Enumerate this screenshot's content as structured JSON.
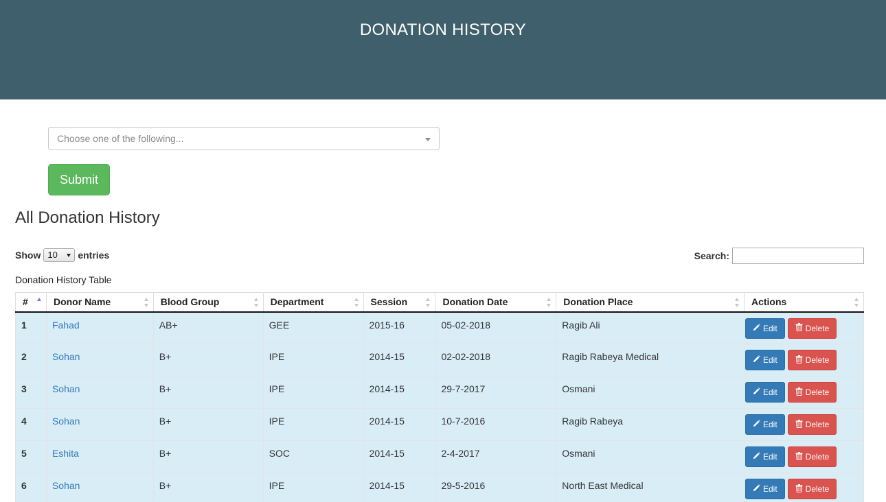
{
  "header": {
    "title": "DONATION HISTORY"
  },
  "form": {
    "select_placeholder": "Choose one of the following...",
    "submit_label": "Submit"
  },
  "section": {
    "title": "All Donation History"
  },
  "datatable": {
    "show_label": "Show",
    "entries_value": "10",
    "entries_label": "entries",
    "search_label": "Search:",
    "caption": "Donation History Table",
    "columns": [
      "#",
      "Donor Name",
      "Blood Group",
      "Department",
      "Session",
      "Donation Date",
      "Donation Place",
      "Actions"
    ],
    "rows": [
      {
        "num": "1",
        "name": "Fahad",
        "blood": "AB+",
        "dept": "GEE",
        "session": "2015-16",
        "date": "05-02-2018",
        "place": "Ragib Ali"
      },
      {
        "num": "2",
        "name": "Sohan",
        "blood": "B+",
        "dept": "IPE",
        "session": "2014-15",
        "date": "02-02-2018",
        "place": "Ragib Rabeya Medical"
      },
      {
        "num": "3",
        "name": "Sohan",
        "blood": "B+",
        "dept": "IPE",
        "session": "2014-15",
        "date": "29-7-2017",
        "place": "Osmani"
      },
      {
        "num": "4",
        "name": "Sohan",
        "blood": "B+",
        "dept": "IPE",
        "session": "2014-15",
        "date": "10-7-2016",
        "place": "Ragib Rabeya"
      },
      {
        "num": "5",
        "name": "Eshita",
        "blood": "B+",
        "dept": "SOC",
        "session": "2014-15",
        "date": "2-4-2017",
        "place": "Osmani"
      },
      {
        "num": "6",
        "name": "Sohan",
        "blood": "B+",
        "dept": "IPE",
        "session": "2014-15",
        "date": "29-5-2016",
        "place": "North East Medical"
      }
    ],
    "edit_label": "Edit",
    "delete_label": "Delete"
  },
  "colors": {
    "header_bg": "#3e5f6b",
    "submit_green": "#5cb85c",
    "row_bg": "#d9edf7",
    "link_blue": "#337ab7",
    "edit_blue": "#337ab7",
    "delete_red": "#d9534f"
  }
}
